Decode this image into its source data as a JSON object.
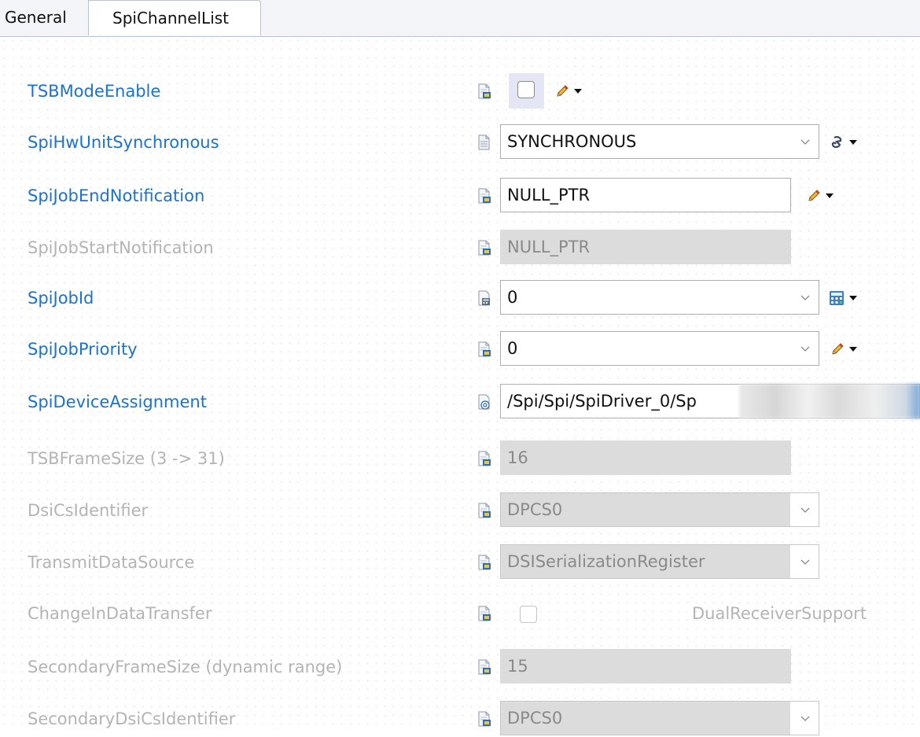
{
  "tabs": [
    {
      "label": "General",
      "active": false
    },
    {
      "label": "SpiChannelList",
      "active": true
    }
  ],
  "rows": [
    {
      "label": "TSBModeEnable",
      "enabled": true,
      "control": "checkbox",
      "checked": false,
      "icon": "param-info-icon",
      "action_icon": "pencil-icon"
    },
    {
      "label": "SpiHwUnitSynchronous",
      "enabled": true,
      "control": "combo",
      "value": "SYNCHRONOUS",
      "icon": "doc-icon",
      "action_icon": "config-icon"
    },
    {
      "label": "SpiJobEndNotification",
      "enabled": true,
      "control": "text",
      "value": "NULL_PTR",
      "icon": "param-info-icon",
      "action_icon": "pencil-icon"
    },
    {
      "label": "SpiJobStartNotification",
      "enabled": false,
      "control": "text",
      "value": "NULL_PTR",
      "icon": "param-info-icon"
    },
    {
      "label": "SpiJobId",
      "enabled": true,
      "control": "combo",
      "value": "0",
      "icon": "calc-icon",
      "action_icon": "calculator-icon"
    },
    {
      "label": "SpiJobPriority",
      "enabled": true,
      "control": "combo",
      "value": "0",
      "icon": "param-info-icon",
      "action_icon": "pencil-icon"
    },
    {
      "label": "SpiDeviceAssignment",
      "enabled": true,
      "control": "reference",
      "value": "/Spi/Spi/SpiDriver_0/Sp",
      "icon": "reference-icon"
    },
    {
      "label": "TSBFrameSize (3 -> 31)",
      "enabled": false,
      "control": "text",
      "value": "16",
      "icon": "param-info-icon"
    },
    {
      "label": "DsiCsIdentifier",
      "enabled": false,
      "control": "combo",
      "value": "DPCS0",
      "icon": "param-info-icon"
    },
    {
      "label": "TransmitDataSource",
      "enabled": false,
      "control": "combo",
      "value": "DSISerializationRegister",
      "icon": "param-info-icon"
    },
    {
      "label": "ChangeInDataTransfer",
      "enabled": false,
      "control": "checkbox",
      "checked": false,
      "icon": "param-info-icon",
      "extra_label": "DualReceiverSupport"
    },
    {
      "label": "SecondaryFrameSize (dynamic range)",
      "enabled": false,
      "control": "text",
      "value": "15",
      "icon": "param-info-icon"
    },
    {
      "label": "SecondaryDsiCsIdentifier",
      "enabled": false,
      "control": "combo",
      "value": "DPCS0",
      "icon": "param-info-icon"
    }
  ],
  "colors": {
    "label_active": "#1a73d4",
    "label_disabled": "#b4b4b4",
    "field_disabled_bg": "#dcdcdc",
    "accent_selection": "#7aa6d8"
  }
}
